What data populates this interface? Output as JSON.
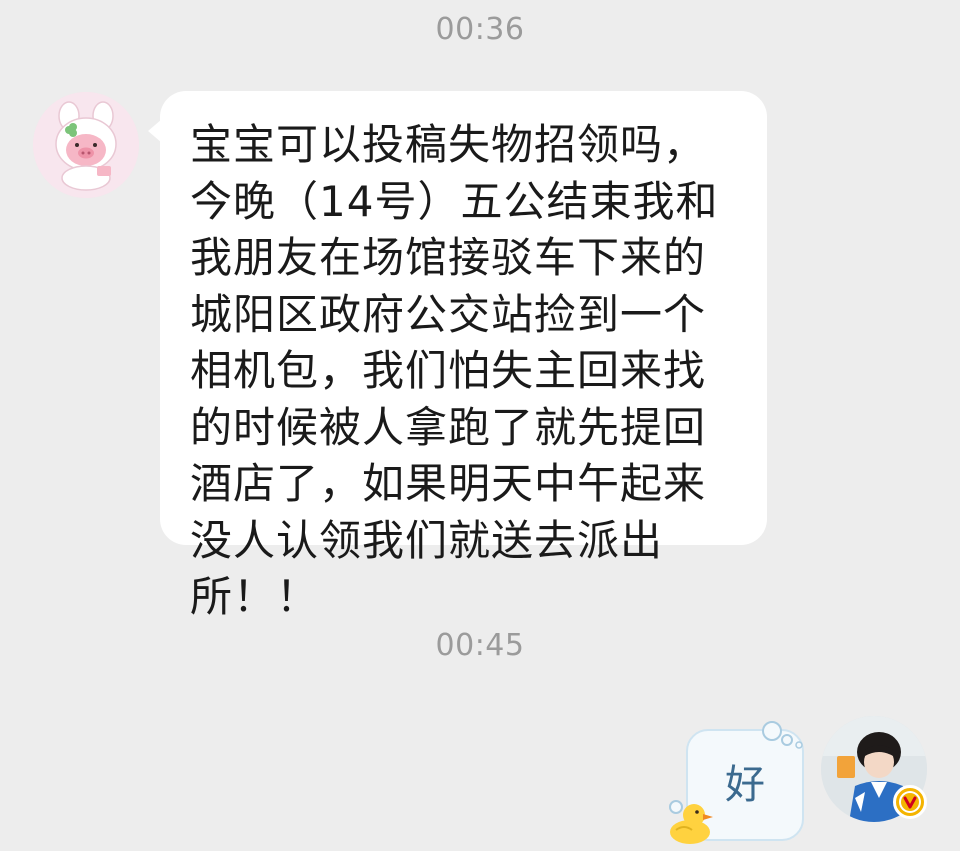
{
  "chat": {
    "messages": [
      {
        "timestamp": "00:36",
        "sender": "incoming",
        "text": "宝宝可以投稿失物招领吗，今晚（14号）五公结束我和我朋友在场馆接驳车下来的城阳区政府公交站捡到一个相机包，我们怕失主回来找的时候被人拿跑了就先提回酒店了，如果明天中午起来没人认领我们就送去派出所！！"
      },
      {
        "timestamp": "00:45",
        "sender": "outgoing",
        "text": "好"
      }
    ]
  },
  "incoming_avatar": {
    "icon": "pink-pig-bunny-avatar-icon"
  },
  "outgoing_avatar": {
    "icon": "user-photo-avatar-icon",
    "badge": "V",
    "badge_color": "#f4b400"
  },
  "outgoing_bubble_theme": {
    "icon": "duck-bubble-theme-icon",
    "border_color": "#cfe4f1"
  }
}
